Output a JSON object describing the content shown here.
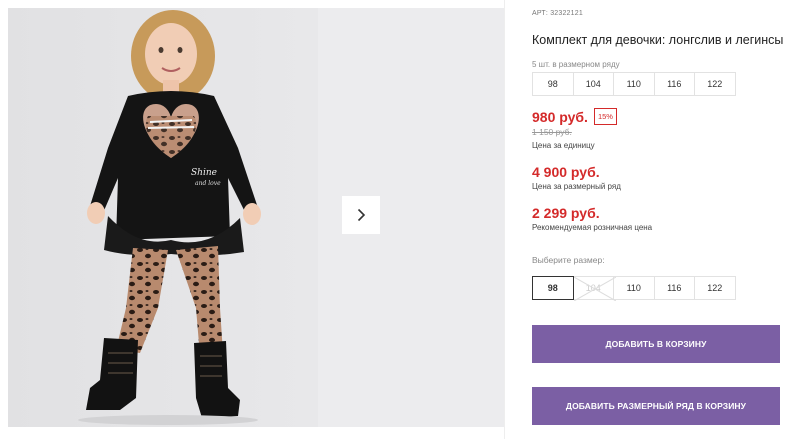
{
  "product": {
    "sku": "АРТ: 32322121",
    "title": "Комплект для девочки: лонгслив и легинсы",
    "pack_note": "5 шт. в размерном ряду",
    "pack_sizes": [
      "98",
      "104",
      "110",
      "116",
      "122"
    ],
    "price": "980 руб.",
    "discount": "15%",
    "old_price": "1 150 руб.",
    "unit_label": "Цена за единицу",
    "pack_price": "4 900 руб.",
    "pack_label": "Цена за размерный ряд",
    "rrp_price": "2 299 руб.",
    "rrp_label": "Рекомендуемая розничная цена",
    "choose_label": "Выберите размер:",
    "pick_sizes": [
      {
        "label": "98",
        "state": "selected"
      },
      {
        "label": "104",
        "state": "disabled"
      },
      {
        "label": "110",
        "state": "normal"
      },
      {
        "label": "116",
        "state": "normal"
      },
      {
        "label": "122",
        "state": "normal"
      }
    ],
    "add_to_cart": "ДОБАВИТЬ В КОРЗИНУ",
    "add_pack_to_cart": "ДОБАВИТЬ РАЗМЕРНЫЙ РЯД В КОРЗИНУ"
  },
  "gallery": {
    "photo_alt": "product-photo",
    "print_text_1": "Shine",
    "print_text_2": "and love",
    "next_icon": "chevron-right-icon"
  },
  "colors": {
    "accent": "#7b5fa4",
    "price_red": "#d42a2a"
  }
}
